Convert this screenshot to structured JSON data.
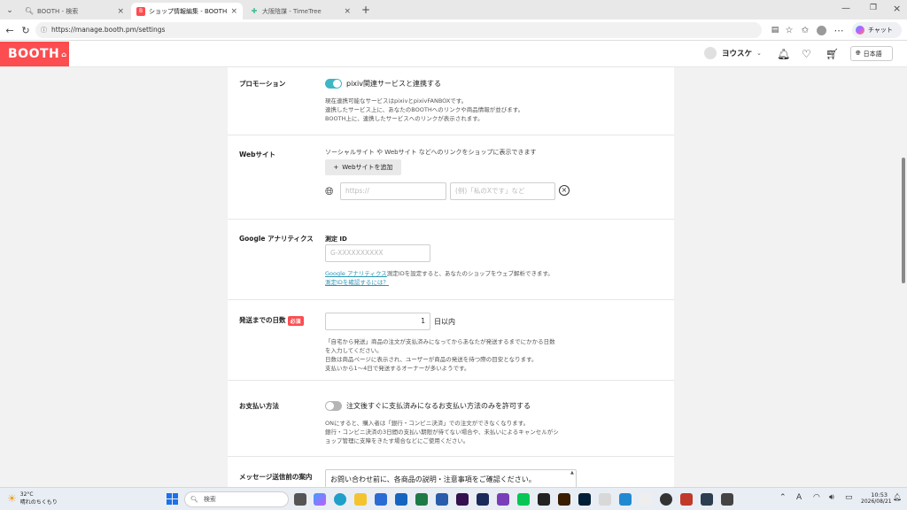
{
  "browser": {
    "tabs": [
      {
        "title": "BOOTH - 検索",
        "icon": "search-icon"
      },
      {
        "title": "ショップ情報編集 - BOOTH",
        "icon": "booth-icon"
      },
      {
        "title": "大阪陰謀 - TimeTree",
        "icon": "timetree-icon"
      }
    ],
    "url": "https://manage.booth.pm/settings",
    "copilot_label": "チャット"
  },
  "header": {
    "logo": "BOOTH",
    "username": "ヨウスケ",
    "language": "日本語"
  },
  "sections": {
    "promotion": {
      "label": "プロモーション",
      "toggle_label": "pixiv関連サービスと連携する",
      "toggle_on": true,
      "desc1": "現在連携可能なサービスはpixivとpixivFANBOXです。",
      "desc2": "連携したサービス上に、あなたのBOOTHへのリンクや商品情報が並びます。",
      "desc3": "BOOTH上に、連携したサービスへのリンクが表示されます。"
    },
    "website": {
      "label": "Webサイト",
      "desc": "ソーシャルサイト や Webサイト などへのリンクをショップに表示できます",
      "add_button": "Webサイトを追加",
      "url_placeholder": "https://",
      "name_placeholder": "(例)「私のXです」など"
    },
    "analytics": {
      "label": "Google アナリティクス",
      "field_label": "測定 ID",
      "placeholder": "G-XXXXXXXXXX",
      "link1": "Google アナリティクス",
      "desc": "測定IDを設定すると、あなたのショップをウェブ解析できます。",
      "link2": "測定IDを確認するには？"
    },
    "shipping": {
      "label": "発送までの日数",
      "required": "必須",
      "value": "1",
      "unit": "日以内",
      "desc1": "「自宅から発送」商品の注文が支払済みになってからあなたが発送するまでにかかる日数",
      "desc2": "を入力してください。",
      "desc3": "日数は商品ページに表示され、ユーザーが商品の発送を待つ際の目安となります。",
      "desc4": "支払いから1〜4日で発送するオーナーが多いようです。"
    },
    "payment": {
      "label": "お支払い方法",
      "toggle_label": "注文後すぐに支払済みになるお支払い方法のみを許可する",
      "toggle_on": false,
      "desc1": "ONにすると、購入者は「銀行・コンビニ決済」での注文ができなくなります。",
      "desc2": "銀行・コンビニ決済の3日間の支払い期限が待てない場合や、未払いによるキャンセルがシ",
      "desc3": "ョップ管理に支障をきたす場合などにご使用ください。"
    },
    "message": {
      "label": "メッセージ送信前の案内",
      "value": "お問い合わせ前に、各商品の説明・注意事項をご確認ください。"
    }
  },
  "taskbar": {
    "temp": "32°C",
    "weather": "晴れのちくもり",
    "search_placeholder": "検索",
    "time": "10:53",
    "date": "2026/08/21",
    "ime": "A"
  }
}
